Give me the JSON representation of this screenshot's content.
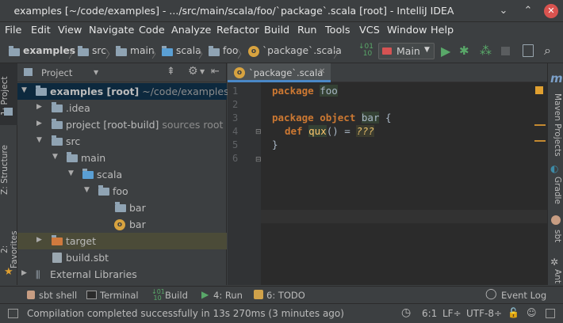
{
  "window": {
    "title": "examples [~/code/examples] - .../src/main/scala/foo/`package`.scala [root] - IntelliJ IDEA",
    "minimize": "⌄",
    "maximize": "⌃",
    "close": "✕"
  },
  "menu": [
    "File",
    "Edit",
    "View",
    "Navigate",
    "Code",
    "Analyze",
    "Refactor",
    "Build",
    "Run",
    "Tools",
    "VCS",
    "Window",
    "Help"
  ],
  "breadcrumbs": {
    "root": "examples",
    "c1": "src",
    "c2": "main",
    "c3": "scala",
    "c4": "foo",
    "c5": "`package`.scala"
  },
  "runconfig": {
    "name": "Main"
  },
  "project_panel": {
    "title": "Project",
    "tree": {
      "examples": "examples [root]",
      "examples_path": "~/code/examples",
      "idea": ".idea",
      "project_build": "project [root-build]",
      "project_build_note": "sources root",
      "src": "src",
      "main": "main",
      "scala": "scala",
      "foo": "foo",
      "bar_pkg": "bar",
      "bar_obj": "bar",
      "target": "target",
      "build_sbt": "build.sbt",
      "external": "External Libraries"
    }
  },
  "left_tabs": {
    "project": "1: Project",
    "structure": "Z: Structure",
    "favorites": "2: Favorites"
  },
  "right_tabs": {
    "m_icon": "m",
    "maven": "Maven Projects",
    "gradle": "Gradle",
    "sbt": "sbt",
    "ant": "Ant"
  },
  "editor": {
    "tab": "`package`.scala",
    "lines": [
      {
        "n": "1"
      },
      {
        "n": "2"
      },
      {
        "n": "3"
      },
      {
        "n": "4"
      },
      {
        "n": "5"
      },
      {
        "n": "6"
      }
    ],
    "code": {
      "l1_kw": "package",
      "l1_name": "foo",
      "l3_kw": "package object",
      "l3_name": "bar",
      "l3_brace": "{",
      "l4_kw": "def",
      "l4_name": "qux",
      "l4_rest": "() =",
      "l4_val": "???",
      "l5": "}"
    }
  },
  "toolwindows": {
    "sbt_shell": "sbt shell",
    "terminal": "Terminal",
    "build": "Build",
    "run": "4: Run",
    "todo": "6: TODO",
    "event_log": "Event Log"
  },
  "status": {
    "message": "Compilation completed successfully in 13s 270ms (3 minutes ago)",
    "position": "6:1",
    "line_sep": "LF÷",
    "encoding": "UTF-8÷"
  },
  "colors": {
    "background": "#3c3f41",
    "editor_bg": "#2b2b2b",
    "selection": "#0d293e",
    "keyword": "#cc7832",
    "accent": "#4a88c7"
  }
}
